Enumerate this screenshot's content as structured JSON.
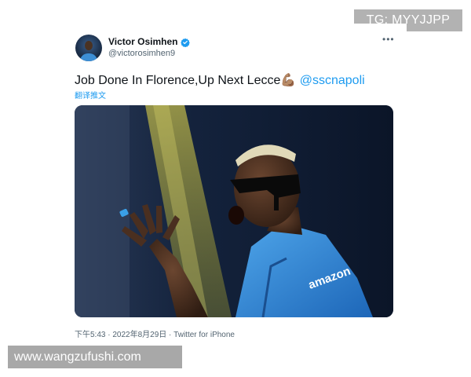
{
  "watermark": {
    "telegram": "TG: MYYJJPP",
    "website": "www.wangzufushi.com"
  },
  "tweet": {
    "author": {
      "display_name": "Victor Osimhen",
      "handle": "@victorosimhen9",
      "verified": true
    },
    "more_icon": "more-horizontal-icon",
    "text": "Job Done In Florence,Up Next Lecce",
    "emoji": "💪🏽",
    "mention": "@sscnapoli",
    "translate_label": "翻译推文",
    "media": {
      "kind": "photo",
      "jersey_text": "amazon"
    },
    "timestamp": "下午5:43 · 2022年8月29日 · Twitter for iPhone"
  },
  "colors": {
    "link": "#1d9bf0",
    "verified": "#1d9bf0",
    "text": "#0f1419",
    "secondary": "#536471",
    "watermark_bg": "#a8a8a8"
  }
}
